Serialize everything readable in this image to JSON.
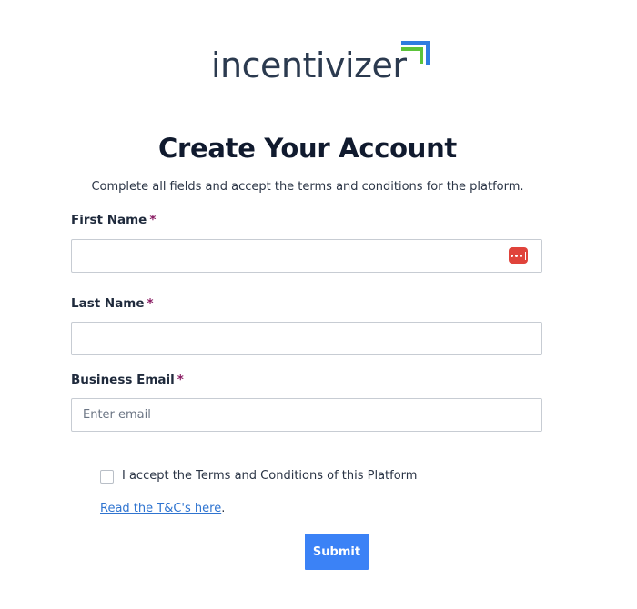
{
  "brand": {
    "logo_text": "incentivizer",
    "logo_colors": {
      "text": "#2b3a4f",
      "arrow_blue": "#2f7de0",
      "arrow_green": "#5cc43a"
    }
  },
  "page": {
    "title": "Create Your Account",
    "subtitle": "Complete all fields and accept the terms and conditions for the platform."
  },
  "form": {
    "first_name": {
      "label": "First Name",
      "required_mark": "*",
      "value": "",
      "placeholder": ""
    },
    "last_name": {
      "label": "Last Name",
      "required_mark": "*",
      "value": "",
      "placeholder": ""
    },
    "business_email": {
      "label": "Business Email",
      "required_mark": "*",
      "value": "",
      "placeholder": "Enter email"
    },
    "password_manager_icon": "password-manager-icon",
    "terms_checkbox": {
      "label": "I accept the Terms and Conditions of this Platform",
      "checked": false
    },
    "terms_link": {
      "text": "Read the T&C's here",
      "trailing": "."
    },
    "submit_label": "Submit"
  },
  "colors": {
    "primary_button": "#3b82f6",
    "link": "#2f74d0",
    "required": "#8a1c63",
    "password_icon": "#e0433b"
  }
}
